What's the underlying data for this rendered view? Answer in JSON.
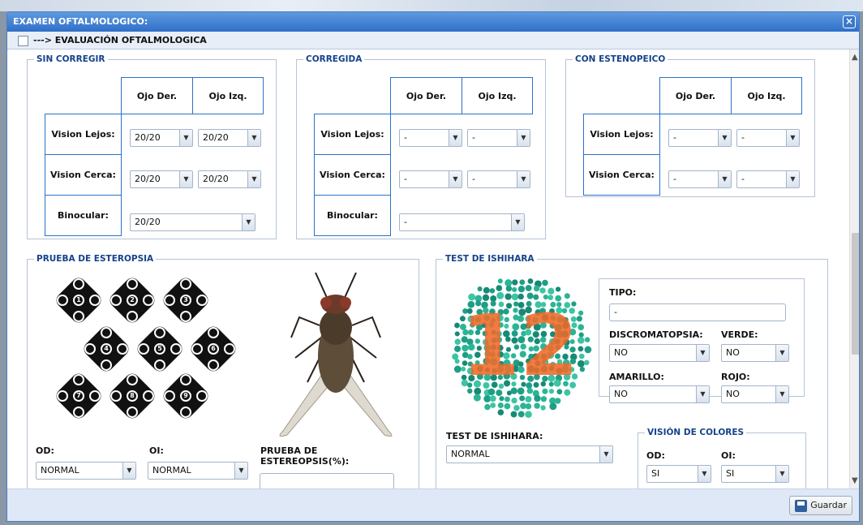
{
  "window": {
    "title": "EXAMEN OFTALMOLOGICO:",
    "close_icon": "close-icon"
  },
  "subbar": {
    "label": "---> EVALUACIÓN OFTALMOLOGICA"
  },
  "headers": {
    "od": "Ojo Der.",
    "oi": "Ojo Izq.",
    "lejos": "Vision Lejos:",
    "cerca": "Vision Cerca:",
    "binocular": "Binocular:"
  },
  "sin_corregir": {
    "title": "SIN CORREGIR",
    "lejos_od": "20/20",
    "lejos_oi": "20/20",
    "cerca_od": "20/20",
    "cerca_oi": "20/20",
    "binocular": "20/20"
  },
  "corregida": {
    "title": "CORREGIDA",
    "lejos_od": "-",
    "lejos_oi": "-",
    "cerca_od": "-",
    "cerca_oi": "-",
    "binocular": "-"
  },
  "estenopeico": {
    "title": "CON ESTENOPEICO",
    "lejos_od": "-",
    "lejos_oi": "-",
    "cerca_od": "-",
    "cerca_oi": "-"
  },
  "esteropsia": {
    "title": "PRUEBA DE ESTEROPSIA",
    "numbers": [
      "1",
      "2",
      "3",
      "4",
      "5",
      "6",
      "7",
      "8",
      "9"
    ],
    "od_label": "OD:",
    "od_value": "NORMAL",
    "oi_label": "OI:",
    "oi_value": "NORMAL",
    "prueba_label": "PRUEBA DE ESTEREOPSIS(%):",
    "prueba_value": ""
  },
  "ishihara": {
    "title": "TEST DE ISHIHARA",
    "plate_number": "12",
    "tipo_label": "TIPO:",
    "tipo_value": "-",
    "discromatopsia_label": "DISCROMATOPSIA:",
    "discromatopsia_value": "NO",
    "verde_label": "VERDE:",
    "verde_value": "NO",
    "amarillo_label": "AMARILLO:",
    "amarillo_value": "NO",
    "rojo_label": "ROJO:",
    "rojo_value": "NO",
    "test_label": "TEST DE ISHIHARA:",
    "test_value": "NORMAL",
    "vision_title": "VISIÓN DE COLORES",
    "v_od_label": "OD:",
    "v_od_value": "SI",
    "v_oi_label": "OI:",
    "v_oi_value": "SI"
  },
  "footer": {
    "save_label": "Guardar"
  },
  "colors": {
    "accent": "#15428b",
    "title": "#2f6fc8",
    "plate_dot": "#26a88a",
    "plate_number": "#ee6a2a"
  }
}
